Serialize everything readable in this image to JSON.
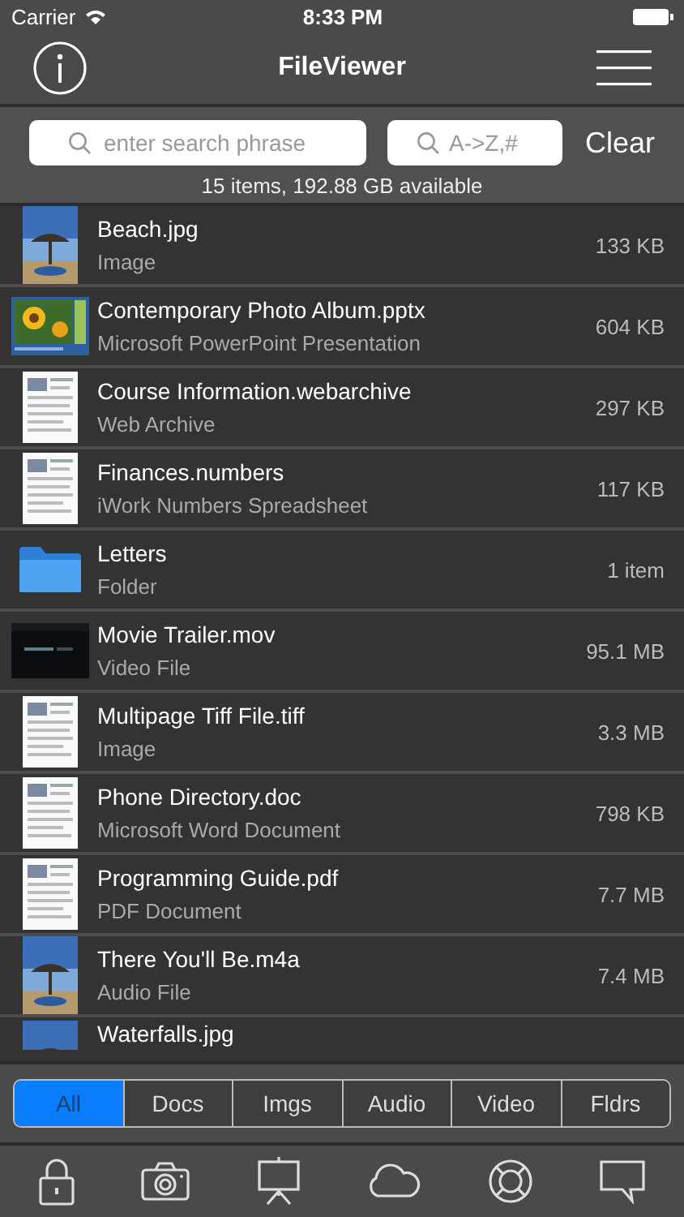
{
  "status_bar": {
    "carrier": "Carrier",
    "time": "8:33 PM"
  },
  "nav": {
    "title": "FileViewer"
  },
  "search": {
    "placeholder": "enter search phrase",
    "index_placeholder": "A->Z,#",
    "clear": "Clear",
    "summary": "15 items, 192.88 GB available"
  },
  "files": [
    {
      "name": "Beach.jpg",
      "type": "Image",
      "size": "133 KB"
    },
    {
      "name": "Contemporary Photo Album.pptx",
      "type": "Microsoft PowerPoint Presentation",
      "size": "604 KB",
      "kind": "slide"
    },
    {
      "name": "Course Information.webarchive",
      "type": "Web Archive",
      "size": "297 KB",
      "kind": "page"
    },
    {
      "name": "Finances.numbers",
      "type": "iWork Numbers Spreadsheet",
      "size": "117 KB",
      "kind": "page"
    },
    {
      "name": "Letters",
      "type": "Folder",
      "size": "1 item",
      "kind": "folder"
    },
    {
      "name": "Movie Trailer.mov",
      "type": "Video File",
      "size": "95.1 MB",
      "kind": "video"
    },
    {
      "name": "Multipage Tiff File.tiff",
      "type": "Image",
      "size": "3.3 MB",
      "kind": "page"
    },
    {
      "name": "Phone Directory.doc",
      "type": "Microsoft Word Document",
      "size": "798 KB",
      "kind": "page"
    },
    {
      "name": "Programming Guide.pdf",
      "type": "PDF Document",
      "size": "7.7 MB",
      "kind": "page"
    },
    {
      "name": "There You'll Be.m4a",
      "type": "Audio File",
      "size": "7.4 MB"
    },
    {
      "name": "Waterfalls.jpg"
    }
  ],
  "filters": [
    {
      "label": "All",
      "selected": true
    },
    {
      "label": "Docs",
      "selected": false
    },
    {
      "label": "Imgs",
      "selected": false
    },
    {
      "label": "Audio",
      "selected": false
    },
    {
      "label": "Video",
      "selected": false
    },
    {
      "label": "Fldrs",
      "selected": false
    }
  ]
}
